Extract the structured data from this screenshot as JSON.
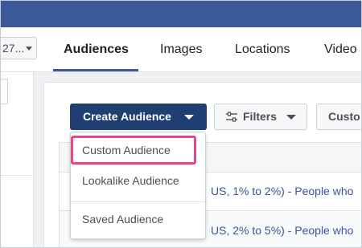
{
  "account_selector": {
    "value": "27..."
  },
  "nav": {
    "tabs": [
      {
        "label": "Audiences",
        "active": true
      },
      {
        "label": "Images",
        "active": false
      },
      {
        "label": "Locations",
        "active": false
      },
      {
        "label": "Video",
        "active": false
      }
    ]
  },
  "toolbar": {
    "create_audience_label": "Create Audience",
    "filters_label": "Filters",
    "customize_label": "Custo"
  },
  "dropdown": {
    "items": [
      {
        "label": "Custom Audience",
        "highlighted": true
      },
      {
        "label": "Lookalike Audience",
        "highlighted": false
      },
      {
        "label": "Saved Audience",
        "highlighted": false
      }
    ]
  },
  "table": {
    "rows": [
      {
        "text": "US, 1% to 2%) - People who"
      },
      {
        "text": "US, 2% to 5%) - People who"
      }
    ]
  },
  "colors": {
    "top_bar": "#3b5998",
    "primary_button": "#1f3f73",
    "link": "#365899",
    "highlight": "#e8467c",
    "tab_underline": "#3b5998"
  },
  "icons": [
    "caret-down-icon",
    "filter-sliders-icon"
  ]
}
